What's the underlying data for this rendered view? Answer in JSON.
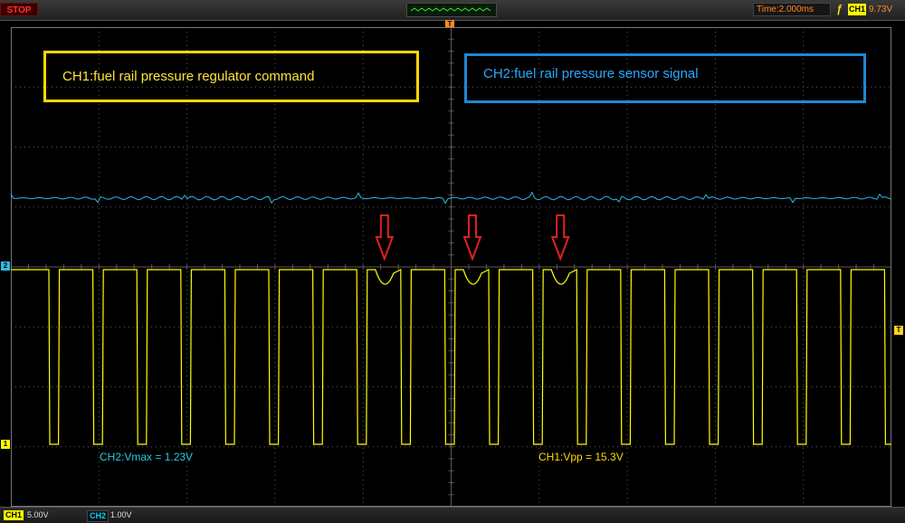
{
  "toolbar": {
    "run_state": "STOP",
    "timebase": "Time:2.000ms",
    "trigger_source": "CH1",
    "trigger_level": "9.73V"
  },
  "status": {
    "ch1_label": "CH1",
    "ch1_scale": "5.00V",
    "ch2_label": "CH2",
    "ch2_scale": "1.00V"
  },
  "markers": {
    "ch1": "1",
    "ch2": "2",
    "trigger": "T",
    "time": "T"
  },
  "annotations": {
    "ch1_box": "CH1:fuel rail pressure regulator command",
    "ch2_box": "CH2:fuel rail pressure sensor signal",
    "ch2_measure": "CH2:Vmax = 1.23V",
    "ch1_measure": "CH1:Vpp = 15.3V"
  },
  "colors": {
    "ch1": "#ffff00",
    "ch2": "#2fb8e8",
    "grid": "#5a5a5a",
    "arrow": "#e02020",
    "ch1_box": "#ffd800",
    "ch2_box": "#1e88d4"
  },
  "icons": {
    "trigger_edge": "rising-edge-icon",
    "arrows": "down-arrow-icon"
  },
  "waveform": {
    "ch1_pulse_count": 20,
    "ch1_anomaly_pulses": [
      8,
      10,
      12
    ],
    "arrows_at_pulses": [
      8,
      10,
      12
    ]
  }
}
